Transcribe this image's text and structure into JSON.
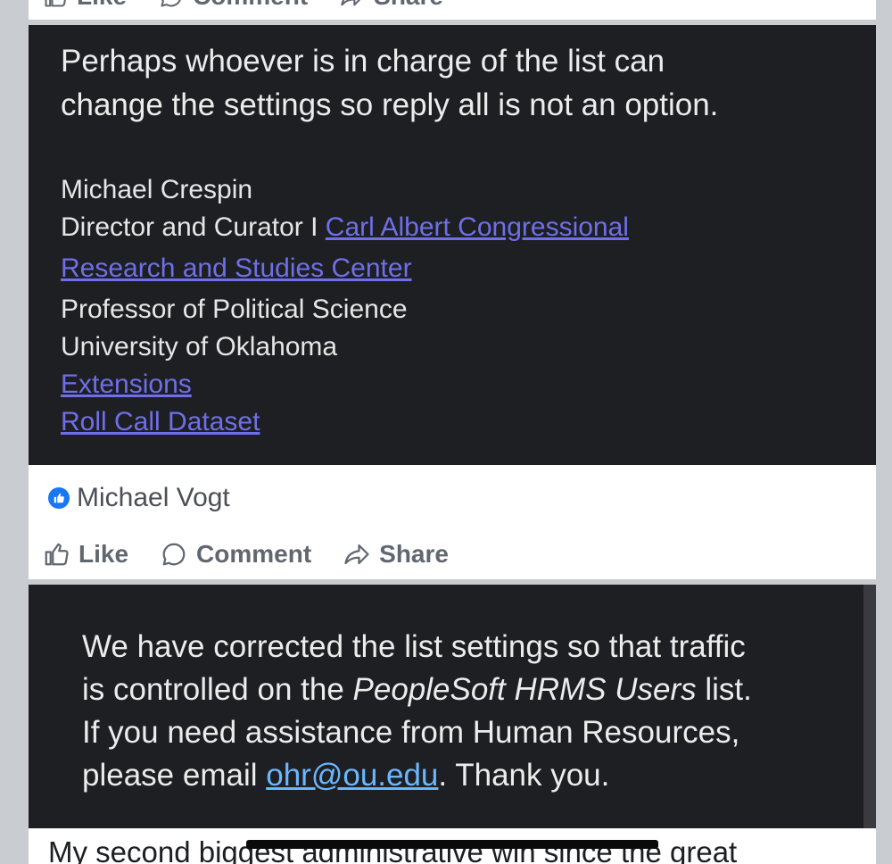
{
  "top_actions": {
    "like": "Like",
    "comment": "Comment",
    "share": "Share"
  },
  "email_1": {
    "body_lines": [
      "Perhaps whoever is in charge of the list can",
      "change the settings so reply all is not an option."
    ],
    "signature": {
      "name": "Michael Crespin",
      "title_prefix": "Director and Curator I ",
      "center_link_line1": "Carl Albert Congressional",
      "center_link_line2": "Research and Studies Center",
      "role": "Professor of Political Science",
      "university": "University of Oklahoma",
      "link_extensions": "Extensions",
      "link_dataset": "Roll Call Dataset"
    }
  },
  "post": {
    "author": "Michael Vogt",
    "actions": {
      "like": "Like",
      "comment": "Comment",
      "share": "Share"
    }
  },
  "email_2": {
    "line1": "We have corrected the list settings so that traffic",
    "line2_pre": "is controlled on the ",
    "line2_em": "PeopleSoft HRMS Users",
    "line2_post": " list.",
    "line3": "If you need assistance from Human Resources,",
    "line4_pre": "please email ",
    "line4_link": "ohr@ou.edu",
    "line4_post": ". Thank you."
  },
  "next_post": {
    "text": "My second biggest administrative win since the great"
  },
  "colors": {
    "background": "#c9ccd1",
    "dark_panel": "#1e1f23",
    "link_purple": "#6f6fe8",
    "link_blue": "#6ab7ff",
    "badge_blue": "#1877f2",
    "action_gray": "#606770"
  }
}
